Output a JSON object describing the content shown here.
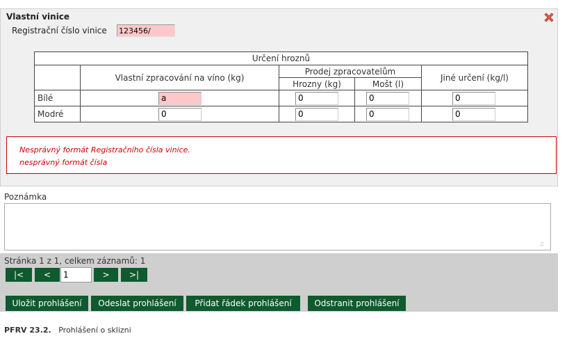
{
  "panel": {
    "title": "Vlastní vinice",
    "reg_label": "Registrační číslo vinice",
    "reg_value": "123456/"
  },
  "table": {
    "main_header": "Určení hroznů",
    "col_own": "Vlastní zpracování na víno (kg)",
    "col_sale": "Prodej zpracovatelům",
    "col_grapes": "Hrozny (kg)",
    "col_must": "Mošt (l)",
    "col_other": "Jiné určení (kg/l)",
    "rows": [
      {
        "label": "Bílé",
        "own": "a",
        "grapes": "0",
        "must": "0",
        "other": "0"
      },
      {
        "label": "Modré",
        "own": "0",
        "grapes": "0",
        "must": "0",
        "other": "0"
      }
    ]
  },
  "errors": [
    "Nesprávný formát Registračního čísla vinice.",
    "nesprávný formát čísla"
  ],
  "note": {
    "label": "Poznámka",
    "value": ""
  },
  "pager": {
    "info": "Stránka 1 z 1, celkem záznamů: 1",
    "first": "|<",
    "prev": "<",
    "page": "1",
    "next": ">",
    "last": ">|"
  },
  "actions": {
    "save": "Uložit prohlášení",
    "send": "Odeslat prohlášení",
    "add_row": "Přidat řádek prohlášení",
    "remove": "Odstranit prohlášení"
  },
  "footer": {
    "code": "PFRV 23.2.",
    "title": "Prohlášení o sklizni"
  },
  "colors": {
    "accent": "#0f5a2e",
    "error": "#cc0000",
    "error_bg": "#ffc8c8"
  }
}
